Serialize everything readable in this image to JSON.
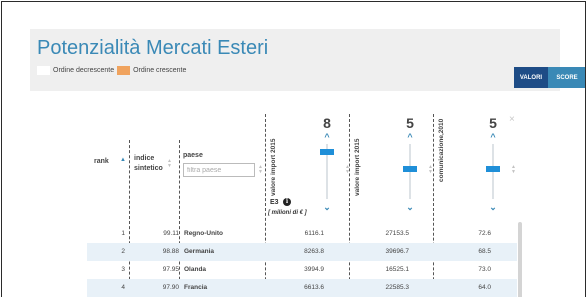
{
  "header": {
    "title": "Potenzialità Mercati Esteri",
    "legend": {
      "desc_label": "Ordine decrescente",
      "asc_label": "Ordine crescente"
    },
    "toggle": {
      "valori": "VALORI",
      "score": "SCORE"
    }
  },
  "close_symbol": "×",
  "columns": {
    "rank": "rank",
    "indice": [
      "indice",
      "sintetico"
    ],
    "paese": "paese",
    "paese_placeholder": "filtra paese",
    "valore_import": "valore import 2015",
    "valore_import_2": "valore import 2015",
    "comunicazione": "comunicazione,2010"
  },
  "weights": [
    {
      "value": "8",
      "level": 0.85
    },
    {
      "value": "5",
      "level": 0.55
    },
    {
      "value": "5",
      "level": 0.55
    }
  ],
  "unit": {
    "code": "E3",
    "info": "i",
    "label": "[ milioni di € ]"
  },
  "rows": [
    {
      "rank": "1",
      "indice": "99.11",
      "paese": "Regno-Unito",
      "v1": "6116.1",
      "v2": "27153.5",
      "v3": "72.6"
    },
    {
      "rank": "2",
      "indice": "98.88",
      "paese": "Germania",
      "v1": "8263.8",
      "v2": "39696.7",
      "v3": "68.5"
    },
    {
      "rank": "3",
      "indice": "97.95",
      "paese": "Olanda",
      "v1": "3994.9",
      "v2": "16525.1",
      "v3": "73.0"
    },
    {
      "rank": "4",
      "indice": "97.90",
      "paese": "Francia",
      "v1": "6613.6",
      "v2": "22585.3",
      "v3": "64.0"
    }
  ],
  "colors": {
    "accent": "#3a89b6",
    "accent_dark": "#1e4c86",
    "orange": "#f0a35e",
    "row_alt": "#e8f1f8"
  }
}
